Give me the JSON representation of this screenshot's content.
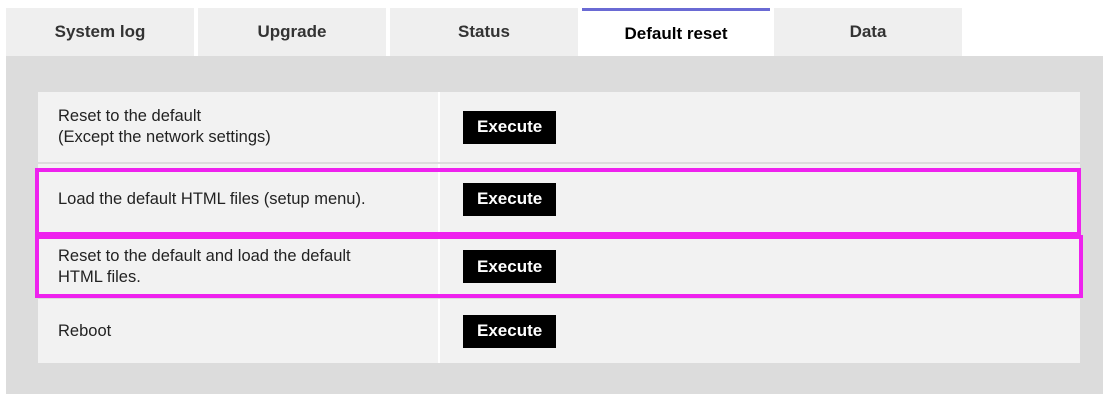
{
  "tabs": [
    {
      "label": "System log"
    },
    {
      "label": "Upgrade"
    },
    {
      "label": "Status"
    },
    {
      "label": "Default reset",
      "active": true
    },
    {
      "label": "Data"
    }
  ],
  "rows": [
    {
      "label": "Reset to the default\n(Except the network settings)",
      "button": "Execute"
    },
    {
      "label": "Load the default HTML files (setup menu).",
      "button": "Execute"
    },
    {
      "label": "Reset to the default and load the default\nHTML files.",
      "button": "Execute"
    },
    {
      "label": "Reboot",
      "button": "Execute"
    }
  ],
  "colors": {
    "highlight": "#ee22ee",
    "active_tab_indicator": "#6a6ad4",
    "panel_background": "#dcdcdc",
    "button_background": "#000000"
  }
}
